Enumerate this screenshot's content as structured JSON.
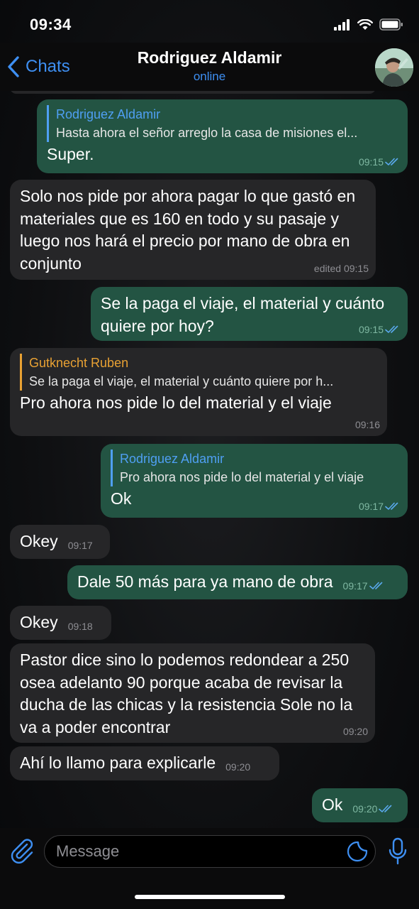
{
  "status_bar": {
    "time": "09:34"
  },
  "header": {
    "back_label": "Chats",
    "title": "Rodriguez Aldamir",
    "subtitle": "online"
  },
  "messages": [
    {
      "direction": "out",
      "reply_name": "Rodriguez Aldamir",
      "reply_text": "Hasta ahora el señor arreglo la casa de misiones el...",
      "text": "Super.",
      "time": "09:15",
      "read": true
    },
    {
      "direction": "in",
      "text": "Solo nos pide por ahora pagar lo que gastó en materiales que es 160 en todo y su pasaje y luego nos hará el precio por mano de obra en conjunto",
      "time": "edited 09:15"
    },
    {
      "direction": "out",
      "text": "Se la paga el viaje, el material y cuánto quiere por hoy?",
      "time": "09:15",
      "read": true
    },
    {
      "direction": "in",
      "reply_name": "Gutknecht Ruben",
      "reply_text": "Se la paga el viaje, el material y cuánto quiere por h...",
      "text": "Pro ahora nos pide lo del material y el viaje",
      "time": "09:16"
    },
    {
      "direction": "out",
      "reply_name": "Rodriguez Aldamir",
      "reply_text": "Pro ahora nos pide lo del material y el viaje",
      "text": "Ok",
      "time": "09:17",
      "read": true
    },
    {
      "direction": "in",
      "text": "Okey",
      "time": "09:17"
    },
    {
      "direction": "out",
      "text": "Dale 50 más para ya mano de obra",
      "time": "09:17",
      "read": true
    },
    {
      "direction": "in",
      "text": "Okey",
      "time": "09:18"
    },
    {
      "direction": "in",
      "text": "Pastor dice sino lo podemos redondear a 250 osea adelanto 90 porque acaba de revisar la ducha de las chicas y la resistencia Sole no la va a poder encontrar",
      "time": "09:20"
    },
    {
      "direction": "in",
      "text": "Ahí lo llamo para explicarle",
      "time": "09:20"
    },
    {
      "direction": "out",
      "text": "Ok",
      "time": "09:20",
      "read": true
    }
  ],
  "composer": {
    "placeholder": "Message"
  },
  "colors": {
    "accent": "#3e8ff2",
    "outgoing_bubble": "#235443",
    "incoming_bubble": "#262628",
    "reply_in_accent": "#e8a133"
  }
}
